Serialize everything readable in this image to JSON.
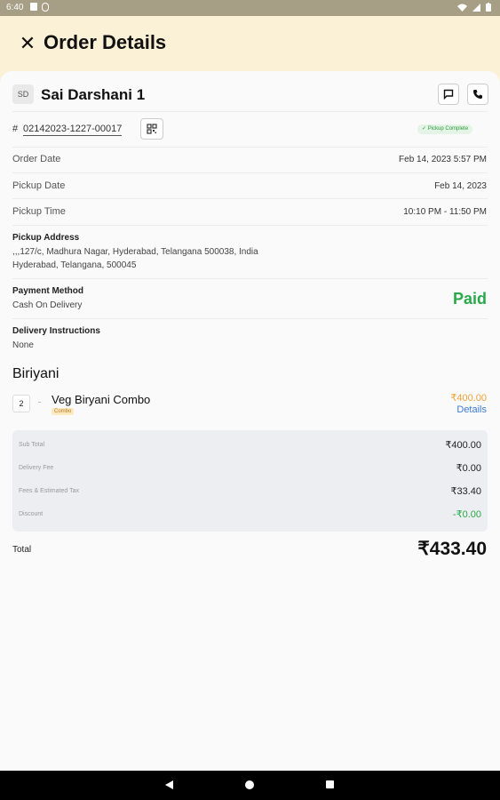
{
  "status_bar": {
    "time": "6:40"
  },
  "header": {
    "title": "Order Details",
    "close_glyph": "✕"
  },
  "customer": {
    "initials": "SD",
    "name": "Sai Darshani 1"
  },
  "order": {
    "hash": "#",
    "number": "02142023-1227-00017",
    "status_badge": "✓ Pickup Complete"
  },
  "details": [
    {
      "label": "Order Date",
      "value": "Feb 14, 2023 5:57 PM"
    },
    {
      "label": "Pickup Date",
      "value": "Feb 14, 2023"
    },
    {
      "label": "Pickup Time",
      "value": "10:10 PM - 11:50 PM"
    }
  ],
  "pickup_address": {
    "title": "Pickup Address",
    "line1": ",,,127/c, Madhura Nagar, Hyderabad, Telangana 500038, India",
    "line2": "Hyderabad, Telangana, 500045"
  },
  "payment": {
    "title": "Payment Method",
    "method": "Cash On Delivery",
    "status": "Paid"
  },
  "delivery_instructions": {
    "title": "Delivery Instructions",
    "value": "None"
  },
  "category": "Biriyani",
  "item": {
    "qty": "2",
    "name": "Veg Biryani Combo",
    "tag": "Combo",
    "price": "₹400.00",
    "details_label": "Details"
  },
  "summary": {
    "rows": [
      {
        "label": "Sub Total",
        "value": "₹400.00"
      },
      {
        "label": "Delivery Fee",
        "value": "₹0.00"
      },
      {
        "label": "Fees & Estimated Tax",
        "value": "₹33.40"
      },
      {
        "label": "Discount",
        "value": "-₹0.00"
      }
    ]
  },
  "total": {
    "label": "Total",
    "value": "₹433.40"
  },
  "colors": {
    "paid": "#2aa84a",
    "price": "#f0a23b",
    "link": "#3e7ad6",
    "discount": "#2aa84a",
    "header_bg": "#fbf1d6"
  },
  "icons": [
    "close-icon",
    "chat-icon",
    "phone-icon",
    "qr-code-icon",
    "check-icon",
    "wifi-icon",
    "signal-icon",
    "battery-icon"
  ]
}
